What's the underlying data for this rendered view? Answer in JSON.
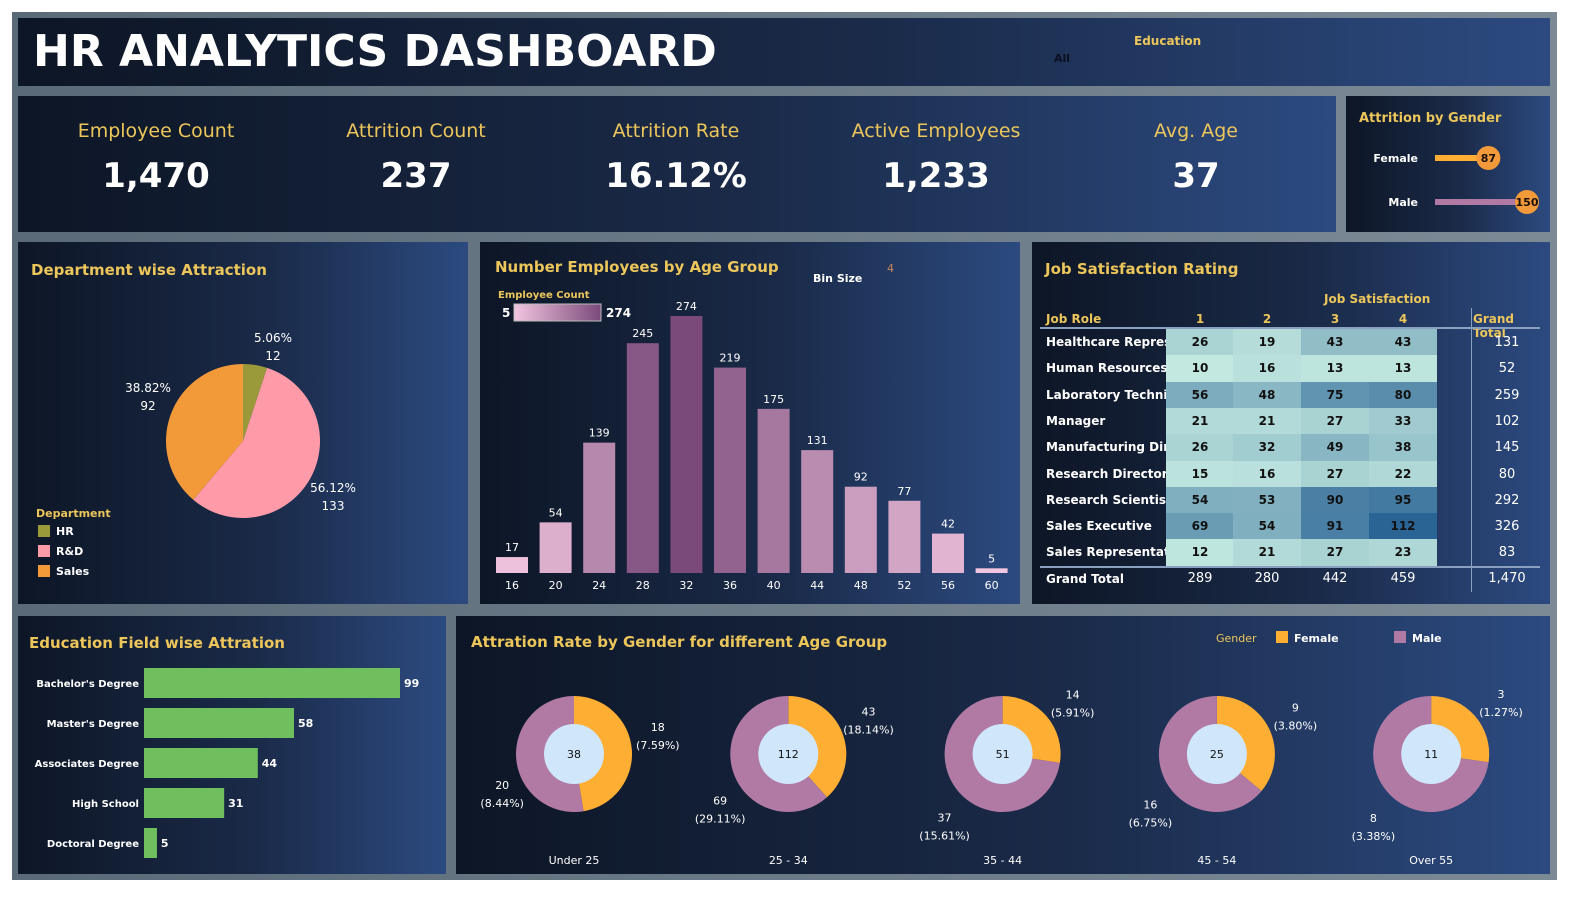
{
  "header": {
    "title": "HR ANALYTICS DASHBOARD",
    "filter_label": "Education",
    "filter_value": "All"
  },
  "kpis": [
    {
      "label": "Employee Count",
      "value": "1,470"
    },
    {
      "label": "Attrition Count",
      "value": "237"
    },
    {
      "label": "Attrition Rate",
      "value": "16.12%"
    },
    {
      "label": "Active Employees",
      "value": "1,233"
    },
    {
      "label": "Avg. Age",
      "value": "37"
    }
  ],
  "colors": {
    "title": "#ecc65a",
    "female": "#ffae34",
    "male": "#b07aa4",
    "education_bar": "#6fbf5f",
    "hr": "#9a9a3a",
    "rnd": "#ff9aa8",
    "sales": "#f29a3a"
  },
  "chart_data": [
    {
      "type": "bar",
      "title": "Attrition by Gender",
      "categories": [
        "Female",
        "Male"
      ],
      "values": [
        87,
        150
      ]
    },
    {
      "type": "pie",
      "title": "Department wise Attraction",
      "legend_title": "Department",
      "legend": "bottom-left",
      "categories": [
        "HR",
        "R&D",
        "Sales"
      ],
      "values": [
        12,
        133,
        92
      ],
      "labels": [
        "5.06%",
        "56.12%",
        "38.82%"
      ]
    },
    {
      "type": "bar",
      "title": "Number Employees by Age Group",
      "bin_size_label": "Bin Size",
      "bin_size": "4",
      "color_legend": {
        "title": "Employee Count",
        "min": "5",
        "max": "274"
      },
      "categories": [
        "16",
        "20",
        "24",
        "28",
        "32",
        "36",
        "40",
        "44",
        "48",
        "52",
        "56",
        "60"
      ],
      "values": [
        17,
        54,
        139,
        245,
        274,
        219,
        175,
        131,
        92,
        77,
        42,
        5
      ]
    },
    {
      "type": "heatmap",
      "title": "Job Satisfaction Rating",
      "column_header": "Job Satisfaction",
      "row_header": "Job Role",
      "columns": [
        "1",
        "2",
        "3",
        "4"
      ],
      "total_label": "Grand Total",
      "rows": [
        {
          "role": "Healthcare Representative",
          "values": [
            26,
            19,
            43,
            43
          ],
          "total": "131"
        },
        {
          "role": "Human Resources",
          "values": [
            10,
            16,
            13,
            13
          ],
          "total": "52"
        },
        {
          "role": "Laboratory Technician",
          "values": [
            56,
            48,
            75,
            80
          ],
          "total": "259"
        },
        {
          "role": "Manager",
          "values": [
            21,
            21,
            27,
            33
          ],
          "total": "102"
        },
        {
          "role": "Manufacturing Director",
          "values": [
            26,
            32,
            49,
            38
          ],
          "total": "145"
        },
        {
          "role": "Research Director",
          "values": [
            15,
            16,
            27,
            22
          ],
          "total": "80"
        },
        {
          "role": "Research Scientist",
          "values": [
            54,
            53,
            90,
            95
          ],
          "total": "292"
        },
        {
          "role": "Sales Executive",
          "values": [
            69,
            54,
            91,
            112
          ],
          "total": "326"
        },
        {
          "role": "Sales Representative",
          "values": [
            12,
            21,
            27,
            23
          ],
          "total": "83"
        }
      ],
      "grand_total": {
        "label": "Grand Total",
        "values": [
          "289",
          "280",
          "442",
          "459"
        ],
        "total": "1,470"
      }
    },
    {
      "type": "bar",
      "orientation": "horizontal",
      "title": "Education Field wise Attration",
      "categories": [
        "Bachelor's Degree",
        "Master's Degree",
        "Associates Degree",
        "High School",
        "Doctoral Degree"
      ],
      "values": [
        99,
        58,
        44,
        31,
        5
      ]
    },
    {
      "type": "pie",
      "subtype": "donut",
      "title": "Attration Rate by Gender for different Age Group",
      "legend_title": "Gender",
      "legend": "top-right",
      "series_names": [
        "Female",
        "Male"
      ],
      "groups": [
        {
          "label": "Under 25",
          "total": "38",
          "female": 18,
          "female_pct": "(7.59%)",
          "male": 20,
          "male_pct": "(8.44%)"
        },
        {
          "label": "25 - 34",
          "total": "112",
          "female": 43,
          "female_pct": "(18.14%)",
          "male": 69,
          "male_pct": "(29.11%)"
        },
        {
          "label": "35 - 44",
          "total": "51",
          "female": 14,
          "female_pct": "(5.91%)",
          "male": 37,
          "male_pct": "(15.61%)"
        },
        {
          "label": "45 - 54",
          "total": "25",
          "female": 9,
          "female_pct": "(3.80%)",
          "male": 16,
          "male_pct": "(6.75%)"
        },
        {
          "label": "Over 55",
          "total": "11",
          "female": 3,
          "female_pct": "(1.27%)",
          "male": 8,
          "male_pct": "(3.38%)"
        }
      ]
    }
  ]
}
